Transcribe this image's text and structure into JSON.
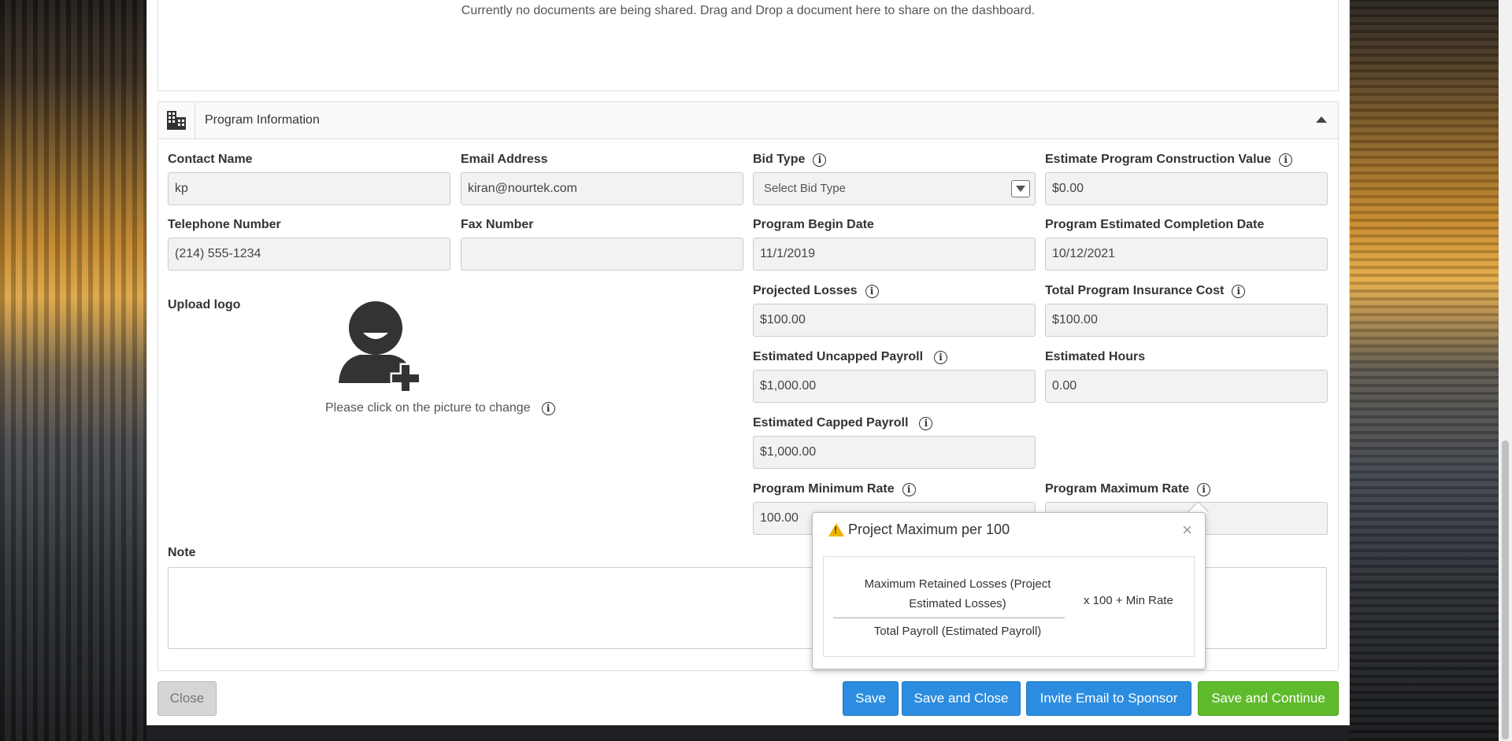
{
  "shared_docs": {
    "empty_message": "Currently no documents are being shared. Drag and Drop a document here to share on the dashboard."
  },
  "section": {
    "title": "Program Information"
  },
  "fields": {
    "contact_name": {
      "label": "Contact Name",
      "value": "kp"
    },
    "email": {
      "label": "Email Address",
      "value": "kiran@nourtek.com"
    },
    "bid_type": {
      "label": "Bid Type",
      "value": "Select Bid Type"
    },
    "construction_value": {
      "label": "Estimate Program Construction Value",
      "value": "$0.00"
    },
    "telephone": {
      "label": "Telephone Number",
      "value": "(214) 555-1234"
    },
    "fax": {
      "label": "Fax Number",
      "value": ""
    },
    "begin_date": {
      "label": "Program Begin Date",
      "value": "11/1/2019"
    },
    "completion_date": {
      "label": "Program Estimated Completion Date",
      "value": "10/12/2021"
    },
    "projected_losses": {
      "label": "Projected Losses",
      "value": "$100.00"
    },
    "insurance_cost": {
      "label": "Total Program Insurance Cost",
      "value": "$100.00"
    },
    "uncapped_payroll": {
      "label": "Estimated Uncapped Payroll",
      "value": "$1,000.00"
    },
    "estimated_hours": {
      "label": "Estimated Hours",
      "value": "0.00"
    },
    "capped_payroll": {
      "label": "Estimated Capped Payroll",
      "value": "$1,000.00"
    },
    "min_rate": {
      "label": "Program Minimum Rate",
      "value": "100.00"
    },
    "max_rate": {
      "label": "Program Maximum Rate",
      "value": ""
    },
    "note": {
      "label": "Note",
      "value": ""
    }
  },
  "upload_logo": {
    "label": "Upload logo",
    "caption": "Please click on the picture to change"
  },
  "popover": {
    "title": "Project Maximum per 100",
    "numerator": "Maximum Retained Losses (Project Estimated Losses)",
    "denominator": "Total Payroll (Estimated Payroll)",
    "multiplier": "x 100 + Min Rate",
    "close_symbol": "×"
  },
  "buttons": {
    "close": "Close",
    "save": "Save",
    "save_and_close": "Save and Close",
    "invite": "Invite Email to Sponsor",
    "save_and_continue": "Save and Continue"
  },
  "icons": {
    "info": "i",
    "section": "building-icon",
    "collapse": "chevron-up-icon",
    "warning": "warning-icon",
    "avatar": "add-user-icon"
  },
  "colors": {
    "primary": "#2c8de0",
    "success": "#5fbb2c",
    "warning": "#f0b400"
  }
}
